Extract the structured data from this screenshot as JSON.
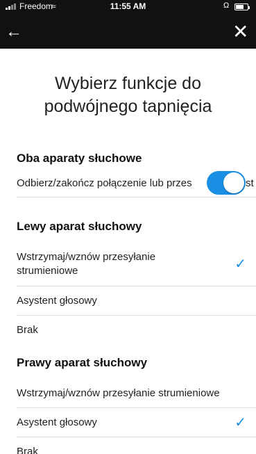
{
  "status_bar": {
    "carrier": "Freedom",
    "wifi_icon": "wifi-icon",
    "time": "11:55 AM",
    "headphone_icon": "headphones-icon",
    "battery_icon": "battery-icon"
  },
  "nav": {
    "back_icon": "←",
    "close_icon": "✕"
  },
  "title": "Wybierz funkcje do podwójnego tapnięcia",
  "sections": {
    "both": {
      "heading": "Oba aparaty słuchowe",
      "row_label": "Odbierz/zakończ połączenie lub przes",
      "row_suffix": "st",
      "toggle_on": true
    },
    "left": {
      "heading": "Lewy aparat słuchowy",
      "items": [
        "Wstrzymaj/wznów przesyłanie strumieniowe",
        "Asystent głosowy",
        "Brak"
      ],
      "check_mark": "✓"
    },
    "right": {
      "heading": "Prawy aparat słuchowy",
      "items": [
        "Wstrzymaj/wznów przesyłanie strumieniowe",
        "Asystent głosowy",
        "Brak"
      ],
      "check_mark": "✓"
    }
  },
  "colors": {
    "accent": "#1a8fe3",
    "topbar": "#111111"
  }
}
